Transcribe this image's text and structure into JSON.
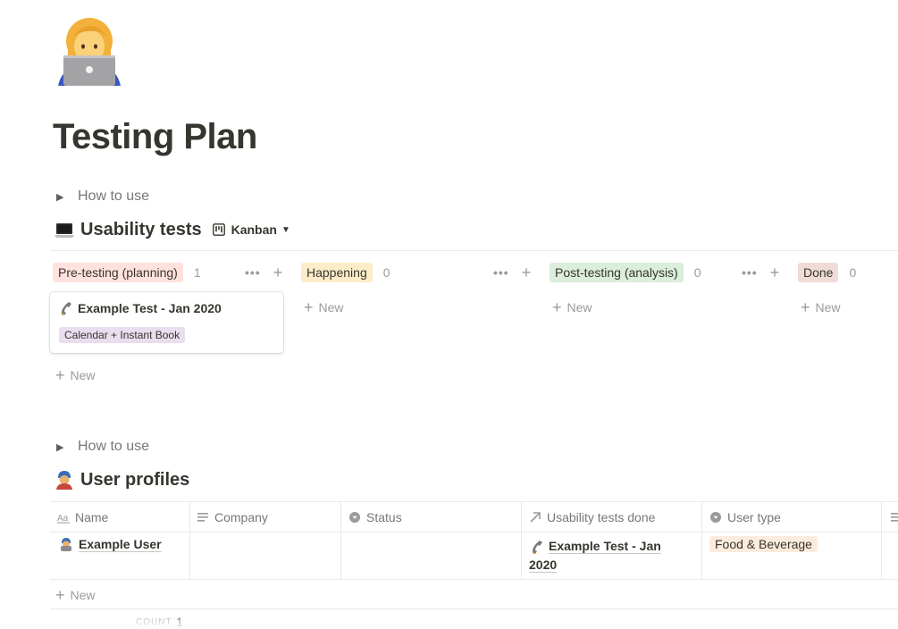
{
  "page": {
    "icon": "woman-technologist-emoji",
    "title": "Testing Plan"
  },
  "usability_section": {
    "toggle_label": "How to use",
    "icon": "laptop-emoji",
    "title": "Usability tests",
    "view_icon": "board-icon",
    "view_label": "Kanban"
  },
  "kanban": {
    "columns": [
      {
        "label": "Pre-testing (planning)",
        "count": "1",
        "color": "#ffe2dd"
      },
      {
        "label": "Happening",
        "count": "0",
        "color": "#fdecc8"
      },
      {
        "label": "Post-testing (analysis)",
        "count": "0",
        "color": "#dbeddb"
      },
      {
        "label": "Done",
        "count": "0",
        "color": "#f0dcd7"
      }
    ],
    "card": {
      "icon": "telephone-receiver-emoji",
      "title": "Example Test - Jan 2020",
      "tag": "Calendar + Instant Book"
    },
    "new_label": "New"
  },
  "profiles_section": {
    "toggle_label": "How to use",
    "icon": "person-with-turban-emoji",
    "title": "User profiles"
  },
  "table": {
    "columns": [
      {
        "label": "Name",
        "icon": "text-aa-icon"
      },
      {
        "label": "Company",
        "icon": "lines-icon"
      },
      {
        "label": "Status",
        "icon": "select-icon"
      },
      {
        "label": "Usability tests done",
        "icon": "relation-arrow-icon"
      },
      {
        "label": "User type",
        "icon": "select-icon"
      }
    ],
    "rows": [
      {
        "name": "Example User",
        "company": "",
        "status": "",
        "tests_done_line1": "Example Test - Jan",
        "tests_done_line2": "2020",
        "user_type": "Food & Beverage"
      }
    ],
    "new_label": "New",
    "count_label": "COUNT",
    "count_value": "1"
  }
}
